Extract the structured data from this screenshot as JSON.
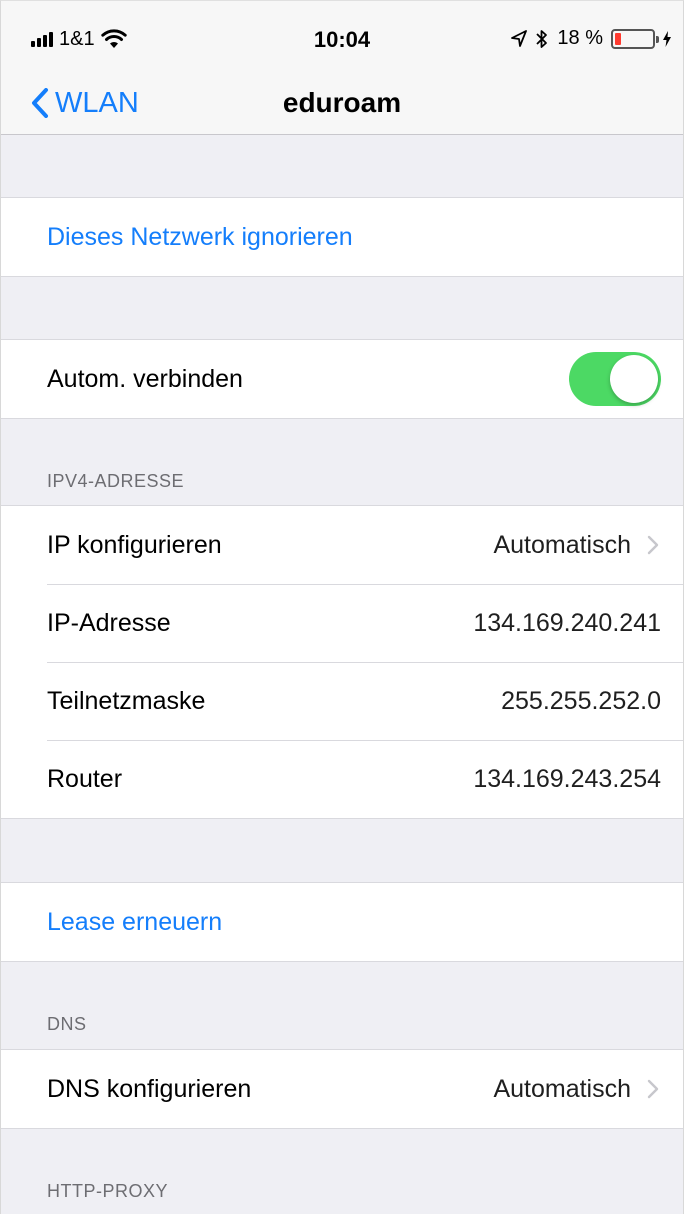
{
  "status_bar": {
    "carrier": "1&1",
    "time": "10:04",
    "battery_percent_text": "18 %",
    "battery_level": 0.18,
    "battery_color": "#ff3b30"
  },
  "nav": {
    "back_label": "WLAN",
    "title": "eduroam"
  },
  "forget_network": {
    "label": "Dieses Netzwerk ignorieren"
  },
  "auto_join": {
    "label": "Autom. verbinden",
    "enabled": true,
    "toggle_color": "#4cd964"
  },
  "ipv4": {
    "header": "IPV4-ADRESSE",
    "rows": [
      {
        "label": "IP konfigurieren",
        "value": "Automatisch",
        "chevron": true
      },
      {
        "label": "IP-Adresse",
        "value": "134.169.240.241"
      },
      {
        "label": "Teilnetzmaske",
        "value": "255.255.252.0"
      },
      {
        "label": "Router",
        "value": "134.169.243.254"
      }
    ]
  },
  "renew_lease": {
    "label": "Lease erneuern"
  },
  "dns": {
    "header": "DNS",
    "row": {
      "label": "DNS konfigurieren",
      "value": "Automatisch"
    }
  },
  "http_proxy": {
    "header": "HTTP-PROXY"
  },
  "colors": {
    "accent": "#147efb",
    "background": "#efeff4"
  },
  "icons": [
    "signal-icon",
    "wifi-icon",
    "location-icon",
    "bluetooth-icon",
    "battery-icon",
    "charging-icon",
    "chevron-left-icon",
    "chevron-right-icon"
  ]
}
